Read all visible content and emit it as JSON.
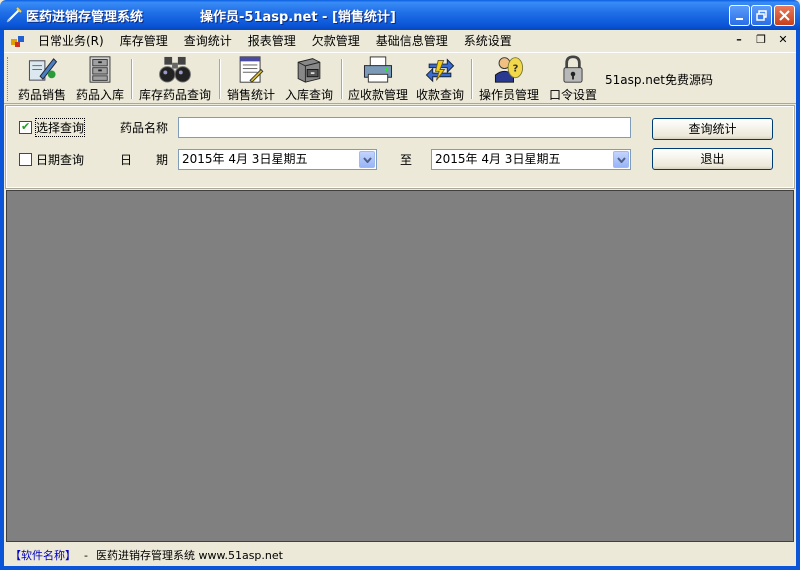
{
  "window": {
    "title": "医药进销存管理系统",
    "operator": "操作员-51asp.net - [销售统计]"
  },
  "menu": {
    "items": [
      "日常业务(R)",
      "库存管理",
      "查询统计",
      "报表管理",
      "欠款管理",
      "基础信息管理",
      "系统设置"
    ]
  },
  "toolbar": {
    "tools": [
      {
        "label": "药品销售",
        "icon": "sales-icon"
      },
      {
        "label": "药品入库",
        "icon": "cabinet-icon"
      },
      {
        "label": "库存药品查询",
        "icon": "binoculars-icon"
      },
      {
        "label": "销售统计",
        "icon": "report-icon"
      },
      {
        "label": "入库查询",
        "icon": "drawer-icon"
      },
      {
        "label": "应收款管理",
        "icon": "printer-icon"
      },
      {
        "label": "收款查询",
        "icon": "exchange-icon"
      },
      {
        "label": "操作员管理",
        "icon": "operator-icon"
      },
      {
        "label": "口令设置",
        "icon": "lock-icon"
      }
    ],
    "note": "51asp.net免费源码"
  },
  "filter": {
    "select_query": {
      "label": "选择查询",
      "checked": true
    },
    "drug_name_label": "药品名称",
    "drug_name_value": "",
    "date_query": {
      "label": "日期查询",
      "checked": false
    },
    "date_label_1": "日",
    "date_label_2": "期",
    "date_from": "2015年  4月  3日星期五",
    "to_label": "至",
    "date_to": "2015年  4月  3日星期五",
    "query_button": "查询统计",
    "exit_button": "退出"
  },
  "status": {
    "key": "【软件名称】",
    "separator": "-",
    "text": "医药进销存管理系统 www.51asp.net"
  }
}
